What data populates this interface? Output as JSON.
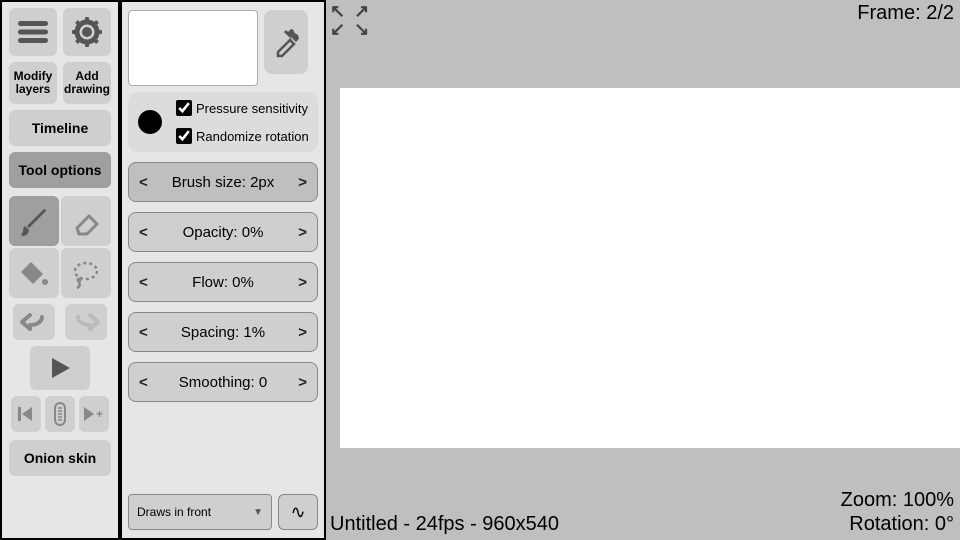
{
  "leftPanel": {
    "modifyLayers1": "Modify",
    "modifyLayers2": "layers",
    "addDrawing1": "Add",
    "addDrawing2": "drawing",
    "timeline": "Timeline",
    "toolOptions": "Tool options",
    "onionSkin": "Onion skin"
  },
  "optPanel": {
    "pressure": "Pressure sensitivity",
    "randomize": "Randomize rotation",
    "brushSize": "Brush size: 2px",
    "opacity": "Opacity: 0%",
    "flow": "Flow: 0%",
    "spacing": "Spacing: 1%",
    "smoothing": "Smoothing: 0",
    "drawsFront": "Draws in front",
    "wave": "∿"
  },
  "canvas": {
    "frame": "Frame: 2/2",
    "zoom": "Zoom: 100%",
    "rotation": "Rotation: 0°",
    "footer": "Untitled - 24fps - 960x540"
  },
  "chart_data": null
}
